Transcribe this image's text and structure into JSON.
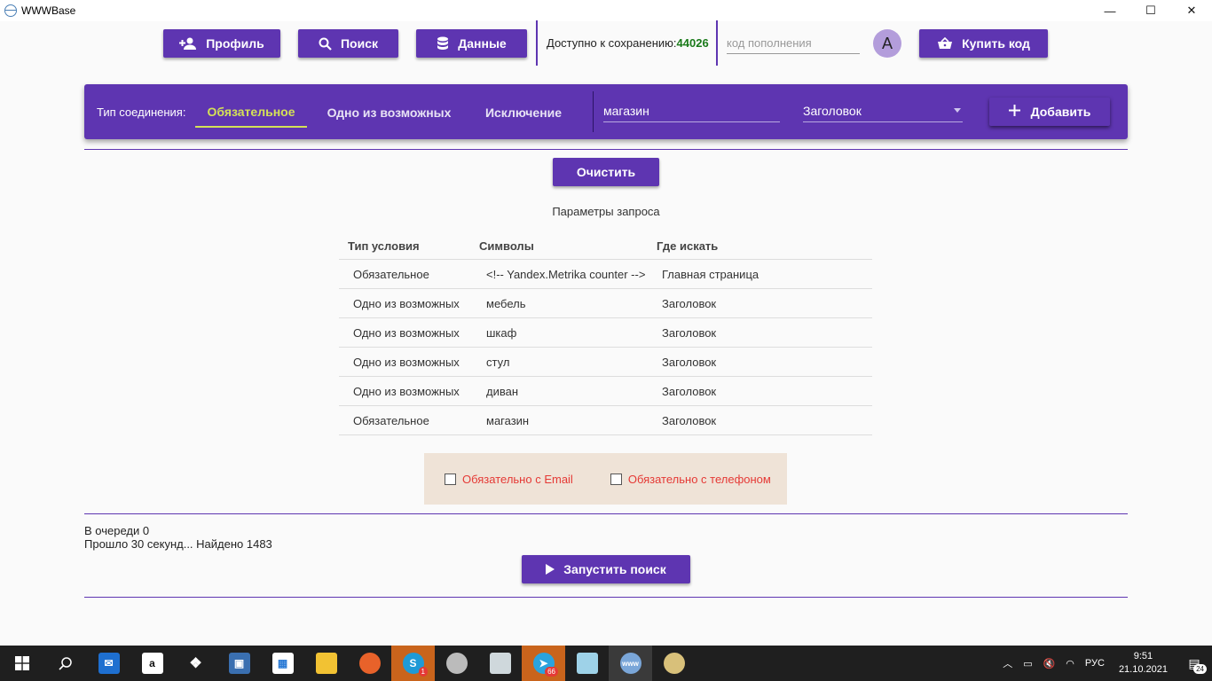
{
  "window": {
    "title": "WWWBase",
    "minimize": "—",
    "maximize": "☐",
    "close": "✕"
  },
  "toolbar": {
    "profile_label": "Профиль",
    "search_label": "Поиск",
    "data_label": "Данные",
    "saves_label": "Доступно к сохранению:",
    "saves_count": "44026",
    "topup_placeholder": "код пополнения",
    "avatar_letter": "A",
    "buy_label": "Купить код"
  },
  "filter_bar": {
    "connection_label": "Тип соединения:",
    "tabs": [
      {
        "label": "Обязательное",
        "active": true
      },
      {
        "label": "Одно из возможных",
        "active": false
      },
      {
        "label": "Исключение",
        "active": false
      }
    ],
    "query_value": "магазин",
    "where_selected": "Заголовок",
    "add_label": "Добавить"
  },
  "clear_label": "Очистить",
  "params": {
    "title": "Параметры запроса",
    "columns": [
      "Тип условия",
      "Символы",
      "Где искать"
    ],
    "rows": [
      [
        "Обязательное",
        "<!-- Yandex.Metrika counter -->",
        "Главная страница"
      ],
      [
        "Одно из возможных",
        "мебель",
        "Заголовок"
      ],
      [
        "Одно из возможных",
        "шкаф",
        "Заголовок"
      ],
      [
        "Одно из возможных",
        "стул",
        "Заголовок"
      ],
      [
        "Одно из возможных",
        "диван",
        "Заголовок"
      ],
      [
        "Обязательное",
        "магазин",
        "Заголовок"
      ]
    ]
  },
  "options": {
    "email_label": "Обязательно с Email",
    "phone_label": "Обязательно с телефоном"
  },
  "status": {
    "queue": "В очереди 0",
    "progress": "Прошло 30 секунд... Найдено 1483"
  },
  "run_label": "Запустить поиск",
  "taskbar": {
    "badge_skype": "1",
    "badge_telegram": "66",
    "lang": "РУС",
    "time": "9:51",
    "date": "21.10.2021",
    "notifications": "24"
  },
  "colors": {
    "primary": "#5e35b1",
    "accent": "#d4e157",
    "count_green": "#1a7a1a",
    "warn_red": "#e53935"
  }
}
